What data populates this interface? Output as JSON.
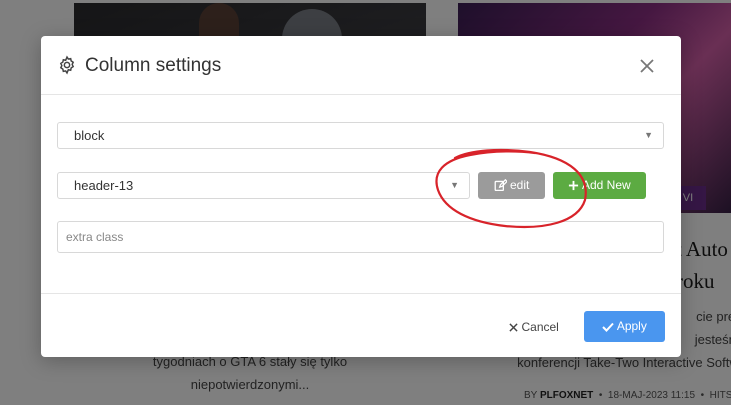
{
  "background": {
    "badge": "VI",
    "title_lines": [
      "t Auto",
      "roku"
    ],
    "excerpt_right_lines": [
      "cie prem",
      "jesteśmy",
      "konferencji Take-Two Interactive Softwa"
    ],
    "excerpt_left_lines": [
      "tygodniach o GTA 6 stały się tylko",
      "niepotwierdzonymi..."
    ],
    "meta": {
      "by": "BY",
      "author": "PLFOXNET",
      "date": "18-MAJ-2023 11:15",
      "hits": "HITS"
    }
  },
  "modal": {
    "title": "Column settings",
    "icons": {
      "title": "gear-icon",
      "close": "close-icon",
      "edit": "edit-icon",
      "add": "plus-icon",
      "cancel": "x-icon",
      "apply": "check-icon"
    },
    "block_select": {
      "value": "block"
    },
    "header_select": {
      "value": "header-13"
    },
    "edit_label": "edit",
    "add_label": "Add New",
    "extra_class": {
      "placeholder": "extra class",
      "value": ""
    },
    "cancel_label": "Cancel",
    "apply_label": "Apply"
  },
  "colors": {
    "edit_button": "#9b9b9b",
    "add_button": "#5cab42",
    "apply_button": "#4a96ef",
    "annotation": "#d8232a"
  }
}
